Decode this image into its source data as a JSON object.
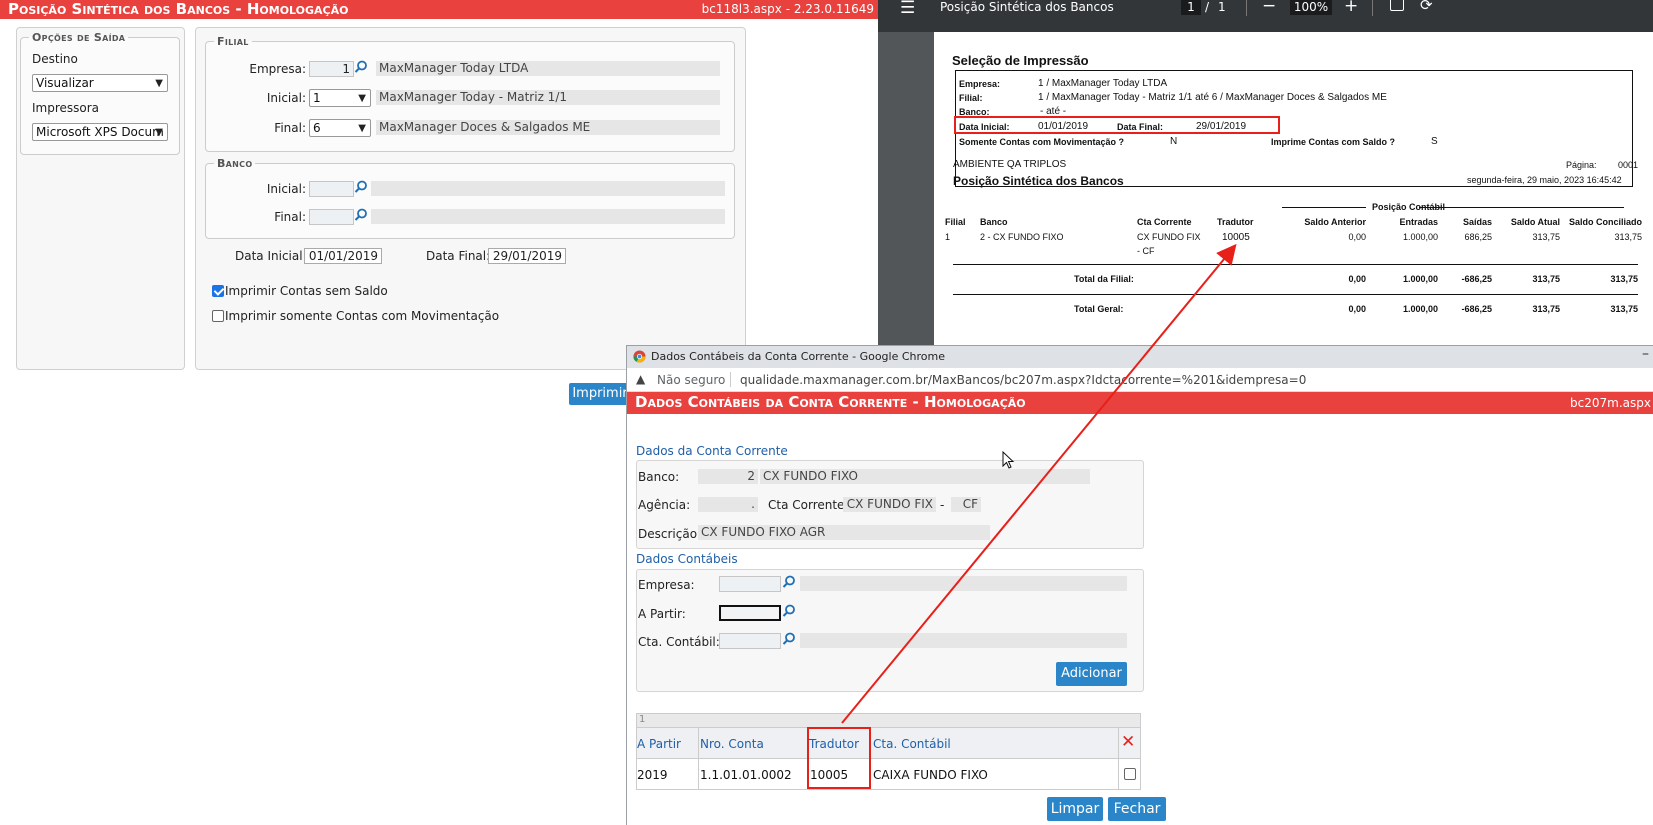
{
  "main": {
    "title": "Posição Sintética dos Bancos - Homologação",
    "code": "bc118l3.aspx - 2.23.0.11649",
    "opcoes": {
      "legend": "Opções de Saída",
      "destino_label": "Destino",
      "destino_value": "Visualizar",
      "impressora_label": "Impressora",
      "impressora_value": "Microsoft XPS Docum"
    },
    "filial": {
      "legend": "Filial",
      "empresa_label": "Empresa:",
      "empresa_value": "1",
      "empresa_name": "MaxManager Today LTDA",
      "inicial_label": "Inicial:",
      "inicial_value": "1",
      "inicial_name": "MaxManager Today - Matriz 1/1",
      "final_label": "Final:",
      "final_value": "6",
      "final_name": "MaxManager Doces & Salgados ME"
    },
    "banco": {
      "legend": "Banco",
      "inicial_label": "Inicial:",
      "final_label": "Final:"
    },
    "data_inicial_label": "Data Inicial:",
    "data_inicial_value": "01/01/2019",
    "data_final_label": "Data Final:",
    "data_final_value": "29/01/2019",
    "chk_sem_saldo": "Imprimir Contas sem Saldo",
    "chk_movimentacao": "Imprimir somente Contas com Movimentação",
    "imprimir_button": "Imprimir"
  },
  "pdf": {
    "title": "Posição Sintética dos Bancos",
    "page_current": "1",
    "page_sep": "/",
    "page_total": "1",
    "zoom": "100%",
    "selecao_title": "Seleção de Impressão",
    "empresa_label": "Empresa:",
    "empresa_value": "1 / MaxManager Today LTDA",
    "filial_label": "Filial:",
    "filial_value": "1 / MaxManager Today - Matriz 1/1 até 6 / MaxManager Doces & Salgados ME",
    "banco_label": "Banco:",
    "banco_value": "- até -",
    "data_inicial_label": "Data Inicial:",
    "data_inicial_value": "01/01/2019",
    "data_final_label": "Data Final:",
    "data_final_value": "29/01/2019",
    "somente_label": "Somente Contas com Movimentação ?",
    "somente_value": "N",
    "imprime_label": "Imprime Contas com Saldo ?",
    "imprime_value": "S",
    "ambiente": "AMBIENTE QA TRIPLOS",
    "pagina_label": "Página:",
    "pagina_value": "0001",
    "report_title": "Posição Sintética dos Bancos",
    "report_date": "segunda-feira, 29 maio, 2023 16:45:42",
    "posicao_contabil": "Posição Contábil",
    "cols": [
      "Filial",
      "Banco",
      "Cta Corrente",
      "Tradutor",
      "Saldo Anterior",
      "Entradas",
      "Saídas",
      "Saldo Atual",
      "Saldo Conciliado"
    ],
    "row": {
      "filial": "1",
      "banco": "2 - CX FUNDO FIXO",
      "cta_l1": "CX FUNDO FIX",
      "cta_l2": "- CF",
      "tradutor": "10005",
      "saldo_anterior": "0,00",
      "entradas": "1.000,00",
      "saidas": "686,25",
      "saldo_atual": "313,75",
      "saldo_conciliado": "313,75"
    },
    "total_filial_label": "Total da Filial:",
    "total_geral_label": "Total Geral:",
    "totals": [
      "0,00",
      "1.000,00",
      "-686,25",
      "313,75",
      "313,75"
    ]
  },
  "popup": {
    "window_title": "Dados Contábeis da Conta Corrente - Google Chrome",
    "not_secure": "Não seguro",
    "url": "qualidade.maxmanager.com.br/MaxBancos/bc207m.aspx?Idctacorrente=%201&idempresa=0",
    "app_title": "Dados Contábeis da Conta Corrente - Homologação",
    "app_code": "bc207m.aspx",
    "sec1_title": "Dados da Conta Corrente",
    "banco_label": "Banco:",
    "banco_num": "2",
    "banco_name": "CX FUNDO FIXO",
    "agencia_label": "Agência:",
    "agencia_value": ".",
    "cta_label": "Cta Corrente:",
    "cta_value": "CX FUNDO FIX",
    "cta_sep": "-",
    "cta_dig": "CF",
    "descricao_label": "Descrição:",
    "descricao_value": "CX FUNDO FIXO AGR",
    "sec2_title": "Dados Contábeis",
    "empresa_label": "Empresa:",
    "apartir_label": "A Partir:",
    "ctacontabil_label": "Cta. Contábil:",
    "adicionar_button": "Adicionar",
    "grid_counter": "1",
    "grid_headers": [
      "A Partir",
      "Nro. Conta",
      "Tradutor",
      "Cta. Contábil"
    ],
    "grid_row": [
      "2019",
      "1.1.01.01.0002",
      "10005",
      "CAIXA FUNDO FIXO"
    ],
    "limpar_button": "Limpar",
    "fechar_button": "Fechar"
  },
  "colors": {
    "title_red": "#e8413e",
    "accent_blue": "#2a86c8",
    "annotation_red": "#e8201a"
  }
}
